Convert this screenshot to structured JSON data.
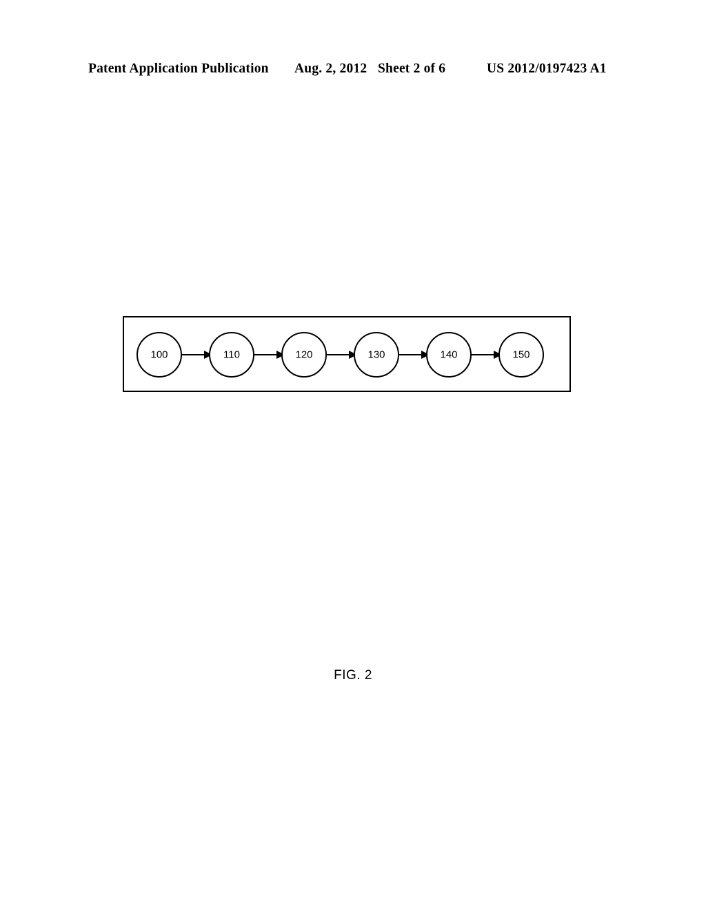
{
  "header": {
    "publication": "Patent Application Publication",
    "date": "Aug. 2, 2012",
    "sheet": "Sheet 2 of 6",
    "publication_number": "US 2012/0197423 A1"
  },
  "figure": {
    "caption": "FIG. 2",
    "diagram": {
      "type": "flow-sequence",
      "frame": {
        "border_color": "#000000"
      },
      "nodes": [
        {
          "id": "n100",
          "label": "100"
        },
        {
          "id": "n110",
          "label": "110"
        },
        {
          "id": "n120",
          "label": "120"
        },
        {
          "id": "n130",
          "label": "130"
        },
        {
          "id": "n140",
          "label": "140"
        },
        {
          "id": "n150",
          "label": "150"
        }
      ],
      "connectors": [
        {
          "from": "100",
          "to": "110",
          "style": "arrow"
        },
        {
          "from": "110",
          "to": "120",
          "style": "arrow"
        },
        {
          "from": "120",
          "to": "130",
          "style": "arrow"
        },
        {
          "from": "130",
          "to": "140",
          "style": "arrow"
        },
        {
          "from": "140",
          "to": "150",
          "style": "arrow"
        }
      ]
    }
  }
}
